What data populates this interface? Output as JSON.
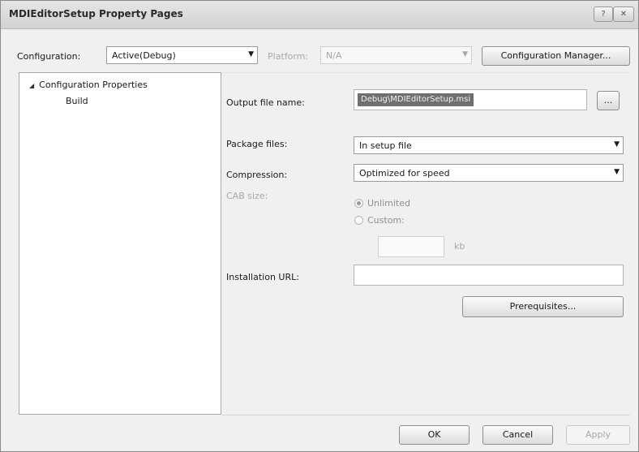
{
  "window": {
    "title": "MDIEditorSetup Property Pages",
    "help_button": "?",
    "close_button": "✕"
  },
  "toolbar": {
    "configuration_label": "Configuration:",
    "configuration_value": "Active(Debug)",
    "platform_label": "Platform:",
    "platform_value": "N/A",
    "configuration_manager_button": "Configuration Manager..."
  },
  "tree": {
    "root_label": "Configuration Properties",
    "child_label": "Build"
  },
  "form": {
    "output_file_name_label": "Output file name:",
    "output_file_name_value": "Debug\\MDIEditorSetup.msi",
    "browse_button": "...",
    "package_files_label": "Package files:",
    "package_files_value": "In setup file",
    "compression_label": "Compression:",
    "compression_value": "Optimized for speed",
    "cab_size_label": "CAB size:",
    "cab_unlimited_label": "Unlimited",
    "cab_custom_label": "Custom:",
    "cab_size_value": "",
    "cab_unit": "kb",
    "installation_url_label": "Installation URL:",
    "installation_url_value": "",
    "prerequisites_button": "Prerequisites..."
  },
  "footer": {
    "ok_button": "OK",
    "cancel_button": "Cancel",
    "apply_button": "Apply"
  }
}
